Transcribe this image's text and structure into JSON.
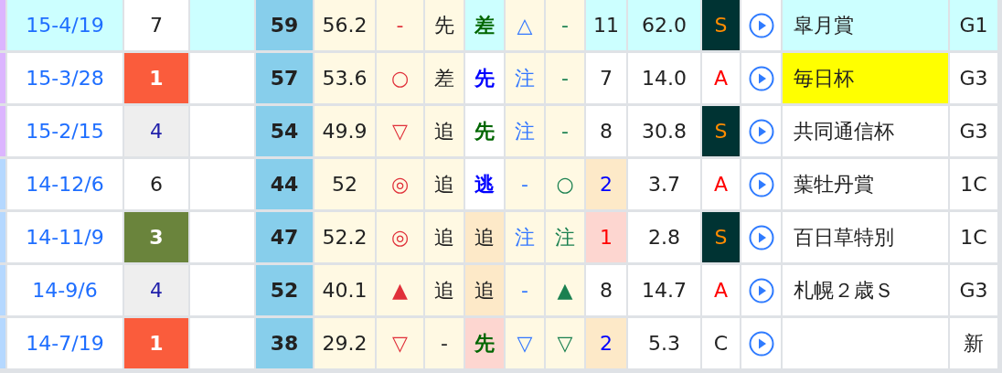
{
  "table": {
    "rows": [
      {
        "color": "#dcb5ff",
        "cells": [
          {
            "kind": "link",
            "text": "15-4/19",
            "color": "#ccffff"
          },
          {
            "kind": "plain",
            "text": "7",
            "color": "#ffffff",
            "bold": false
          },
          {
            "kind": "blank",
            "color": "#ccffff"
          },
          {
            "kind": "plain",
            "text": "59",
            "color": "#87ceeb"
          },
          {
            "kind": "plain",
            "text": "56.2",
            "color": "#fff9e3"
          },
          {
            "kind": "red",
            "text": "-",
            "color": "#fff9e3"
          },
          {
            "kind": "plain",
            "text": "先",
            "color": "#fff9e3"
          },
          {
            "kind": "green",
            "text": "差",
            "color": "#ccffff",
            "bold": true
          },
          {
            "kind": "sky",
            "text": "△",
            "color": "#fff9e3"
          },
          {
            "kind": "teal",
            "text": "-",
            "color": "#fff9e3"
          },
          {
            "kind": "plain",
            "text": "11",
            "color": "#ccffff"
          },
          {
            "kind": "plain",
            "text": "62.0",
            "color": "#ccffff"
          },
          {
            "kind": "orange",
            "text": "S",
            "color": "#003333"
          },
          {
            "kind": "play",
            "color": "#ffffff"
          },
          {
            "kind": "plain",
            "text": "皐月賞",
            "color": "#ccffff"
          },
          {
            "kind": "plain",
            "text": "G1",
            "color": "#ccffff"
          }
        ]
      },
      {
        "color": "#dcb5ff",
        "cells": [
          {
            "kind": "link",
            "text": "15-3/28",
            "color": "#ffffff"
          },
          {
            "kind": "white",
            "text": "1",
            "color": "#fa5c3c",
            "bold": true
          },
          {
            "kind": "blank",
            "color": "#ffffff"
          },
          {
            "kind": "plain",
            "text": "57",
            "color": "#87ceeb"
          },
          {
            "kind": "plain",
            "text": "53.6",
            "color": "#fff9e3"
          },
          {
            "kind": "red",
            "text": "○",
            "color": "#fff9e3"
          },
          {
            "kind": "plain",
            "text": "差",
            "color": "#fff9e3"
          },
          {
            "kind": "blue",
            "text": "先",
            "color": "#ffffff",
            "bold": true
          },
          {
            "kind": "sky",
            "text": "注",
            "color": "#fff9e3"
          },
          {
            "kind": "teal",
            "text": "-",
            "color": "#fff9e3"
          },
          {
            "kind": "plain",
            "text": "7",
            "color": "#ffffff"
          },
          {
            "kind": "plain",
            "text": "14.0",
            "color": "#ffffff"
          },
          {
            "kind": "bright",
            "text": "A",
            "color": "#ffffff"
          },
          {
            "kind": "play",
            "color": "#ffffff"
          },
          {
            "kind": "plain",
            "text": "毎日杯",
            "color": "#ffff00"
          },
          {
            "kind": "plain",
            "text": "G3",
            "color": "#ffffff"
          }
        ]
      },
      {
        "color": "#dcb5ff",
        "cells": [
          {
            "kind": "link",
            "text": "15-2/15",
            "color": "#ffffff"
          },
          {
            "kind": "navy",
            "text": "4",
            "color": "#eeeeee",
            "bold": false
          },
          {
            "kind": "blank",
            "color": "#ffffff"
          },
          {
            "kind": "plain",
            "text": "54",
            "color": "#87ceeb"
          },
          {
            "kind": "plain",
            "text": "49.9",
            "color": "#fff9e3"
          },
          {
            "kind": "red",
            "text": "▽",
            "color": "#fff9e3"
          },
          {
            "kind": "plain",
            "text": "追",
            "color": "#fff9e3"
          },
          {
            "kind": "green",
            "text": "先",
            "color": "#ffffff",
            "bold": true
          },
          {
            "kind": "sky",
            "text": "注",
            "color": "#fff9e3"
          },
          {
            "kind": "teal",
            "text": "-",
            "color": "#fff9e3"
          },
          {
            "kind": "plain",
            "text": "8",
            "color": "#ffffff"
          },
          {
            "kind": "plain",
            "text": "30.8",
            "color": "#ffffff"
          },
          {
            "kind": "orange",
            "text": "S",
            "color": "#003333"
          },
          {
            "kind": "play",
            "color": "#ffffff"
          },
          {
            "kind": "plain",
            "text": "共同通信杯",
            "color": "#ffffff"
          },
          {
            "kind": "plain",
            "text": "G3",
            "color": "#ffffff"
          }
        ]
      },
      {
        "color": "#b5d8ff",
        "cells": [
          {
            "kind": "link",
            "text": "14-12/6",
            "color": "#ffffff"
          },
          {
            "kind": "plain",
            "text": "6",
            "color": "#ffffff",
            "bold": false
          },
          {
            "kind": "blank",
            "color": "#ffffff"
          },
          {
            "kind": "plain",
            "text": "44",
            "color": "#87ceeb"
          },
          {
            "kind": "plain",
            "text": "52",
            "color": "#fff9e3"
          },
          {
            "kind": "red",
            "text": "◎",
            "color": "#fff9e3"
          },
          {
            "kind": "plain",
            "text": "追",
            "color": "#fff9e3"
          },
          {
            "kind": "blue",
            "text": "逃",
            "color": "#ffffff",
            "bold": true
          },
          {
            "kind": "sky",
            "text": "-",
            "color": "#fff9e3"
          },
          {
            "kind": "teal",
            "text": "○",
            "color": "#fff9e3"
          },
          {
            "kind": "blue",
            "text": "2",
            "color": "#fde9c8"
          },
          {
            "kind": "plain",
            "text": "3.7",
            "color": "#ffffff"
          },
          {
            "kind": "bright",
            "text": "A",
            "color": "#ffffff"
          },
          {
            "kind": "play",
            "color": "#ffffff"
          },
          {
            "kind": "plain",
            "text": "葉牡丹賞",
            "color": "#ffffff"
          },
          {
            "kind": "plain",
            "text": "1C",
            "color": "#ffffff"
          }
        ]
      },
      {
        "color": "#b5d8ff",
        "cells": [
          {
            "kind": "link",
            "text": "14-11/9",
            "color": "#ffffff"
          },
          {
            "kind": "white",
            "text": "3",
            "color": "#6a843c",
            "bold": true
          },
          {
            "kind": "blank",
            "color": "#ffffff"
          },
          {
            "kind": "plain",
            "text": "47",
            "color": "#87ceeb"
          },
          {
            "kind": "plain",
            "text": "52.2",
            "color": "#fff9e3"
          },
          {
            "kind": "red",
            "text": "◎",
            "color": "#fff9e3"
          },
          {
            "kind": "plain",
            "text": "追",
            "color": "#fff9e3"
          },
          {
            "kind": "plain",
            "text": "追",
            "color": "#fde9c8",
            "bold": false
          },
          {
            "kind": "sky",
            "text": "注",
            "color": "#fff9e3"
          },
          {
            "kind": "teal",
            "text": "注",
            "color": "#fff9e3"
          },
          {
            "kind": "bright",
            "text": "1",
            "color": "#fdd6d0"
          },
          {
            "kind": "plain",
            "text": "2.8",
            "color": "#ffffff"
          },
          {
            "kind": "orange",
            "text": "S",
            "color": "#003333"
          },
          {
            "kind": "play",
            "color": "#ffffff"
          },
          {
            "kind": "plain",
            "text": "百日草特別",
            "color": "#ffffff"
          },
          {
            "kind": "plain",
            "text": "1C",
            "color": "#ffffff"
          }
        ]
      },
      {
        "color": "#b5d8ff",
        "cells": [
          {
            "kind": "link",
            "text": "14-9/6",
            "color": "#ffffff"
          },
          {
            "kind": "navy",
            "text": "4",
            "color": "#eeeeee",
            "bold": false
          },
          {
            "kind": "blank",
            "color": "#ffffff"
          },
          {
            "kind": "plain",
            "text": "52",
            "color": "#87ceeb"
          },
          {
            "kind": "plain",
            "text": "40.1",
            "color": "#fff9e3"
          },
          {
            "kind": "red",
            "text": "▲",
            "color": "#fff9e3"
          },
          {
            "kind": "plain",
            "text": "追",
            "color": "#fff9e3"
          },
          {
            "kind": "plain",
            "text": "追",
            "color": "#fde9c8",
            "bold": false
          },
          {
            "kind": "sky",
            "text": "-",
            "color": "#fff9e3"
          },
          {
            "kind": "teal",
            "text": "▲",
            "color": "#fff9e3"
          },
          {
            "kind": "plain",
            "text": "8",
            "color": "#ffffff"
          },
          {
            "kind": "plain",
            "text": "14.7",
            "color": "#ffffff"
          },
          {
            "kind": "bright",
            "text": "A",
            "color": "#ffffff"
          },
          {
            "kind": "play",
            "color": "#ffffff"
          },
          {
            "kind": "plain",
            "text": "札幌２歳Ｓ",
            "color": "#ffffff"
          },
          {
            "kind": "plain",
            "text": "G3",
            "color": "#ffffff"
          }
        ]
      },
      {
        "color": "#b5d8ff",
        "cells": [
          {
            "kind": "link",
            "text": "14-7/19",
            "color": "#ffffff"
          },
          {
            "kind": "white",
            "text": "1",
            "color": "#fa5c3c",
            "bold": true
          },
          {
            "kind": "blank",
            "color": "#ffffff"
          },
          {
            "kind": "plain",
            "text": "38",
            "color": "#87ceeb"
          },
          {
            "kind": "plain",
            "text": "29.2",
            "color": "#fff9e3"
          },
          {
            "kind": "red",
            "text": "▽",
            "color": "#fff9e3"
          },
          {
            "kind": "plain",
            "text": "-",
            "color": "#fff9e3"
          },
          {
            "kind": "green",
            "text": "先",
            "color": "#fdd6d0",
            "bold": true
          },
          {
            "kind": "sky",
            "text": "▽",
            "color": "#fff9e3"
          },
          {
            "kind": "teal",
            "text": "▽",
            "color": "#fff9e3"
          },
          {
            "kind": "blue",
            "text": "2",
            "color": "#fde9c8"
          },
          {
            "kind": "plain",
            "text": "5.3",
            "color": "#ffffff"
          },
          {
            "kind": "plain",
            "text": "C",
            "color": "#ffffff"
          },
          {
            "kind": "play",
            "color": "#ffffff"
          },
          {
            "kind": "blank",
            "color": "#ffffff"
          },
          {
            "kind": "plain",
            "text": "新",
            "color": "#ffffff"
          }
        ]
      }
    ]
  }
}
